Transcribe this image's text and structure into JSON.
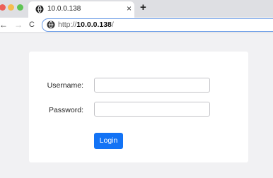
{
  "browser": {
    "tab": {
      "title": "10.0.0.138",
      "close_glyph": "×"
    },
    "new_tab_glyph": "+",
    "nav": {
      "back_glyph": "←",
      "forward_glyph": "→",
      "reload_glyph": "C"
    },
    "address": {
      "scheme": "http://",
      "host": "10.0.0.138",
      "path": "/"
    }
  },
  "login_form": {
    "username_label": "Username:",
    "username_value": "",
    "password_label": "Password:",
    "password_value": "",
    "submit_label": "Login"
  },
  "colors": {
    "accent": "#1373f5",
    "window_close": "#ec5f57",
    "window_minimize": "#f5bd4f",
    "window_maximize": "#5fc454"
  }
}
